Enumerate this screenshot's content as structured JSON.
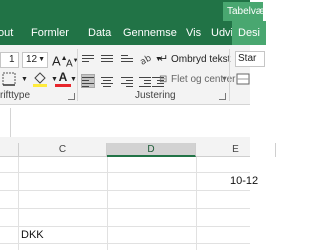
{
  "titlebar": {
    "table_tools_tag": "Tabelvæ"
  },
  "tabs": [
    {
      "label": "out",
      "active": false
    },
    {
      "label": "Formler",
      "active": false
    },
    {
      "label": "Data",
      "active": false
    },
    {
      "label": "Gennemse",
      "active": false
    },
    {
      "label": "Vis",
      "active": false
    },
    {
      "label": "Udvikler",
      "active": false
    },
    {
      "label": "Desi",
      "active": true
    }
  ],
  "ribbon": {
    "font_size_partial": "1",
    "font_size": "12",
    "wrap_text_label": "Ombryd tekst",
    "merge_center_label": "Flet og centrer",
    "style_partial": "Star",
    "font_group_label": "rifttype",
    "alignment_group_label": "Justering",
    "font_color_accent": "#e8262c"
  },
  "columns": [
    "C",
    "D",
    "E"
  ],
  "cells": {
    "e_row2_value": "10-12",
    "c_row5_value": "DKK"
  }
}
